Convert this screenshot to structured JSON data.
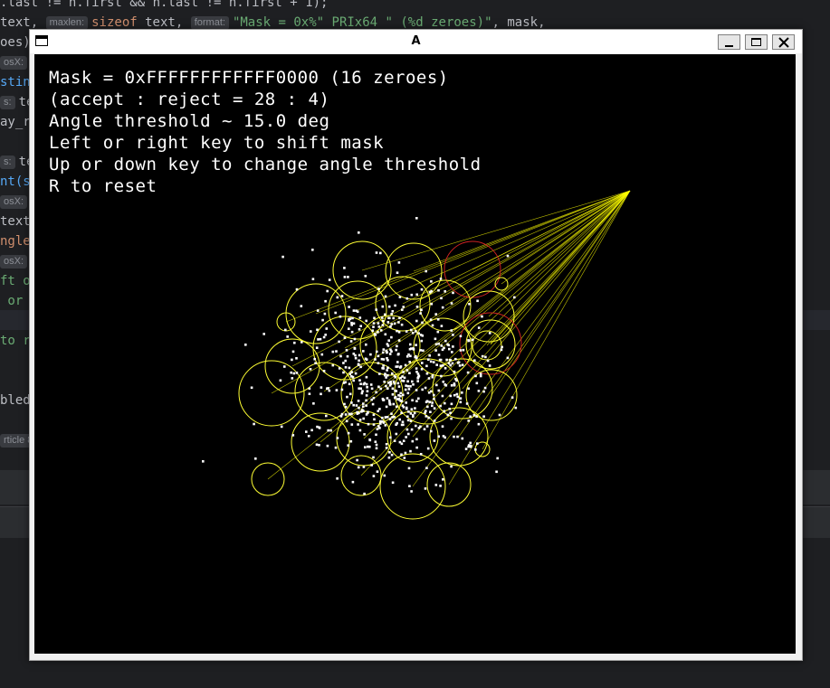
{
  "editor": {
    "lines": [
      {
        "segments": [
          {
            "t": ".last != h.first && h.last != h.first + 1);",
            "c": ""
          }
        ]
      },
      {
        "segments": [
          {
            "t": "text, ",
            "c": ""
          },
          {
            "t": "maxlen:",
            "c": "hint"
          },
          {
            "t": "sizeof",
            "c": "kw"
          },
          {
            "t": " text, ",
            "c": ""
          },
          {
            "t": "format:",
            "c": "hint"
          },
          {
            "t": "\"Mask = 0x%\" PRIx64 \" (%d zeroes)\"",
            "c": "str"
          },
          {
            "t": ", mask,",
            "c": ""
          }
        ]
      },
      {
        "segments": [
          {
            "t": "oes)",
            "c": ""
          }
        ]
      },
      {
        "segments": [
          {
            "t": "osX:",
            "c": "hint"
          }
        ]
      },
      {
        "segments": [
          {
            "t": "stin",
            "c": "fn"
          }
        ]
      },
      {
        "segments": [
          {
            "t": "s:",
            "c": "hint"
          },
          {
            "t": "te",
            "c": ""
          }
        ]
      },
      {
        "segments": [
          {
            "t": "ay_r",
            "c": ""
          }
        ]
      },
      {
        "segments": [
          {
            "t": "",
            "c": ""
          }
        ]
      },
      {
        "segments": [
          {
            "t": "s:",
            "c": "hint"
          },
          {
            "t": "te",
            "c": ""
          }
        ]
      },
      {
        "segments": [
          {
            "t": "nt(s",
            "c": "fn"
          }
        ]
      },
      {
        "segments": [
          {
            "t": "osX:",
            "c": "hint"
          }
        ]
      },
      {
        "segments": [
          {
            "t": "text",
            "c": ""
          }
        ]
      },
      {
        "segments": [
          {
            "t": "ngle",
            "c": "kw"
          }
        ]
      },
      {
        "segments": [
          {
            "t": "osX:",
            "c": "hint"
          }
        ]
      },
      {
        "segments": [
          {
            "t": "ft o",
            "c": "str"
          }
        ]
      },
      {
        "segments": [
          {
            "t": " or ",
            "c": "str"
          }
        ]
      },
      {
        "segments": [
          {
            "t": "",
            "c": ""
          }
        ]
      },
      {
        "segments": [
          {
            "t": "to r",
            "c": "str"
          }
        ]
      },
      {
        "segments": [
          {
            "t": "",
            "c": ""
          }
        ]
      },
      {
        "segments": [
          {
            "t": "",
            "c": ""
          }
        ]
      },
      {
        "segments": [
          {
            "t": "bled",
            "c": ""
          }
        ]
      },
      {
        "segments": [
          {
            "t": "",
            "c": ""
          }
        ]
      },
      {
        "segments": [
          {
            "t": "rticle 8",
            "c": "hint"
          }
        ]
      }
    ]
  },
  "window": {
    "title": "A",
    "icons": {
      "app": "window-icon",
      "minimize": "minimize-icon",
      "maximize": "maximize-icon",
      "close": "close-icon"
    }
  },
  "overlay": {
    "lines": [
      "Mask = 0xFFFFFFFFFFFF0000 (16 zeroes)",
      "(accept : reject = 28 : 4)",
      "Angle threshold ~ 15.0 deg",
      "Left or right key to shift mask",
      "Up or down key to change angle threshold",
      "R to reset"
    ]
  },
  "scene": {
    "colors": {
      "background": "#000000",
      "accepted": "#ffff33",
      "rejected": "#cc2222",
      "points": "#ffffff",
      "rays": "#ffff00"
    },
    "accept_count": 28,
    "reject_count": 4
  }
}
